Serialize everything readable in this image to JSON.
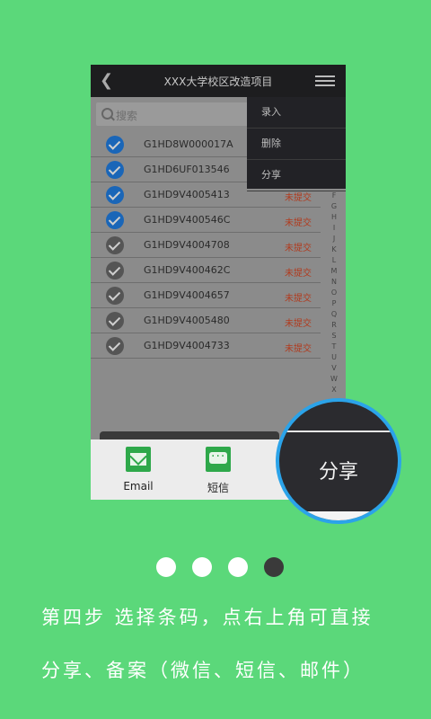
{
  "app": {
    "title": "XXX大学校区改造项目",
    "back_icon": "chevron-left-icon",
    "menu_icon": "list-menu-icon"
  },
  "search": {
    "placeholder": "搜索"
  },
  "popup_menu": [
    "录入",
    "删除",
    "分享"
  ],
  "rows": [
    {
      "code": "G1HD8W000017A",
      "status": "",
      "selected": true
    },
    {
      "code": "G1HD6UF013546",
      "status": "",
      "selected": true
    },
    {
      "code": "G1HD9V4005413",
      "status": "未提交",
      "selected": true
    },
    {
      "code": "G1HD9V400546C",
      "status": "未提交",
      "selected": true
    },
    {
      "code": "G1HD9V4004708",
      "status": "未提交",
      "selected": false
    },
    {
      "code": "G1HD9V400462C",
      "status": "未提交",
      "selected": false
    },
    {
      "code": "G1HD9V4004657",
      "status": "未提交",
      "selected": false
    },
    {
      "code": "G1HD9V4005480",
      "status": "未提交",
      "selected": false
    },
    {
      "code": "G1HD9V4004733",
      "status": "未提交",
      "selected": false
    }
  ],
  "index_letters": [
    "F",
    "G",
    "H",
    "I",
    "J",
    "K",
    "L",
    "M",
    "N",
    "O",
    "P",
    "Q",
    "R",
    "S",
    "T",
    "U",
    "V",
    "W",
    "X"
  ],
  "share_apps": [
    {
      "label": "Email",
      "icon": "email-icon"
    },
    {
      "label": "短信",
      "icon": "sms-icon"
    }
  ],
  "zoom": {
    "label": "分享"
  },
  "pager": {
    "count": 4,
    "active": 4
  },
  "caption": {
    "line1": "第四步 选择条码，点右上角可直接",
    "line2": "分享、备案（微信、短信、邮件）"
  },
  "colors": {
    "background": "#5bd87a",
    "selected": "#1a66b8",
    "status": "#b13a1d",
    "ring": "#2ba3e9"
  }
}
